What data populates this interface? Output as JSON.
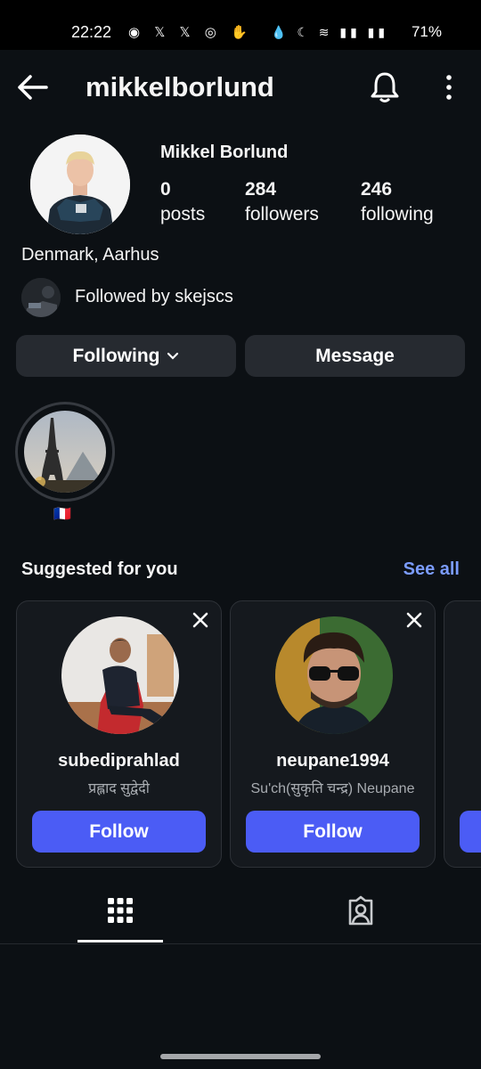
{
  "status_bar": {
    "time": "22:22",
    "battery": "71%"
  },
  "header": {
    "username": "mikkelborlund"
  },
  "profile": {
    "full_name": "Mikkel Borlund",
    "stats": [
      {
        "value": "0",
        "label": "posts"
      },
      {
        "value": "284",
        "label": "followers"
      },
      {
        "value": "246",
        "label": "following"
      }
    ],
    "location": "Denmark, Aarhus",
    "followed_by": "Followed by skejscs"
  },
  "actions": {
    "following_label": "Following",
    "message_label": "Message"
  },
  "highlight": {
    "label": "🇫🇷"
  },
  "suggested": {
    "title": "Suggested for you",
    "see_all": "See all",
    "cards": [
      {
        "username": "subediprahlad",
        "subtitle": "प्रह्लाद सुद्वेदी",
        "follow_label": "Follow"
      },
      {
        "username": "neupane1994",
        "subtitle": "Su'ch(सुकृति चन्द्र) Neupane",
        "follow_label": "Follow"
      }
    ]
  },
  "colors": {
    "background": "#0c1014",
    "accent": "#4b5cf5",
    "link": "#7b9cff"
  }
}
